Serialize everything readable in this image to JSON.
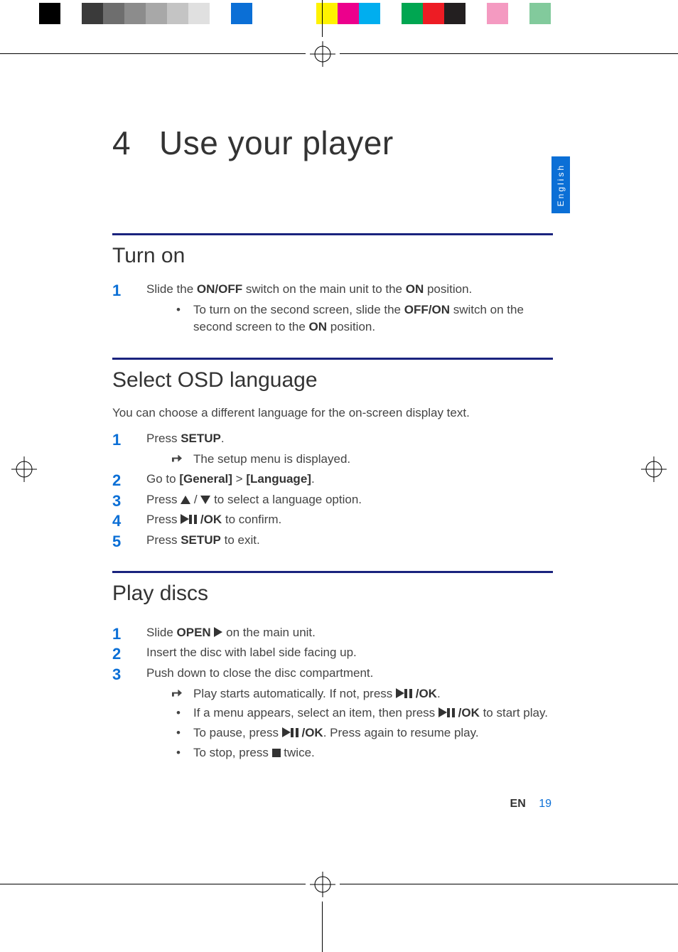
{
  "colorbar": [
    "#000000",
    "#ffffff",
    "#3a3a3a",
    "#6e6e6e",
    "#8c8c8c",
    "#a8a8a8",
    "#c4c4c4",
    "#e0e0e0",
    "#ffffff",
    "#0b6fd6",
    "#ffffff",
    "#ffffff",
    "#ffffff",
    "#fff200",
    "#ec008c",
    "#00aeef",
    "#ffffff",
    "#00a651",
    "#ed1c24",
    "#231f20",
    "#ffffff",
    "#f49ac1",
    "#ffffff",
    "#82ca9c",
    "#ffffff"
  ],
  "language_tab": "English",
  "chapter": {
    "number": "4",
    "title": "Use your player"
  },
  "sections": {
    "turn_on": {
      "heading": "Turn on",
      "step1_a": "Slide the ",
      "step1_b": "ON/OFF",
      "step1_c": " switch on the main unit to the ",
      "step1_d": "ON",
      "step1_e": " position.",
      "sub1_a": "To turn on the second screen, slide the ",
      "sub1_b": "OFF/ON",
      "sub1_c": " switch on the second screen to the ",
      "sub1_d": "ON",
      "sub1_e": " position."
    },
    "osd": {
      "heading": "Select OSD language",
      "intro": "You can choose a different language for the on-screen display text.",
      "s1_a": "Press ",
      "s1_b": "SETUP",
      "s1_c": ".",
      "s1_sub": "The setup menu is displayed.",
      "s2_a": "Go to ",
      "s2_b": "[General]",
      "s2_c": " > ",
      "s2_d": "[Language]",
      "s2_e": ".",
      "s3_a": "Press ",
      "s3_b": " / ",
      "s3_c": " to select a language option.",
      "s4_a": "Press ",
      "s4_b": " /OK",
      "s4_c": " to confirm.",
      "s5_a": "Press ",
      "s5_b": "SETUP",
      "s5_c": " to exit."
    },
    "play": {
      "heading": "Play discs",
      "s1_a": "Slide ",
      "s1_b": "OPEN",
      "s1_c": " on the main unit.",
      "s2": "Insert the disc with label side facing up.",
      "s3": "Push down to close the disc compartment.",
      "s3_r_a": "Play starts automatically. If not, press ",
      "s3_r_b": " /OK",
      "s3_r_c": ".",
      "s3_b1_a": "If a menu appears, select an item, then press ",
      "s3_b1_b": " /OK",
      "s3_b1_c": " to start play.",
      "s3_b2_a": "To pause, press ",
      "s3_b2_b": " /OK",
      "s3_b2_c": ". Press again to resume play.",
      "s3_b3_a": "To stop, press ",
      "s3_b3_b": " twice."
    }
  },
  "footer": {
    "lang": "EN",
    "page": "19"
  }
}
